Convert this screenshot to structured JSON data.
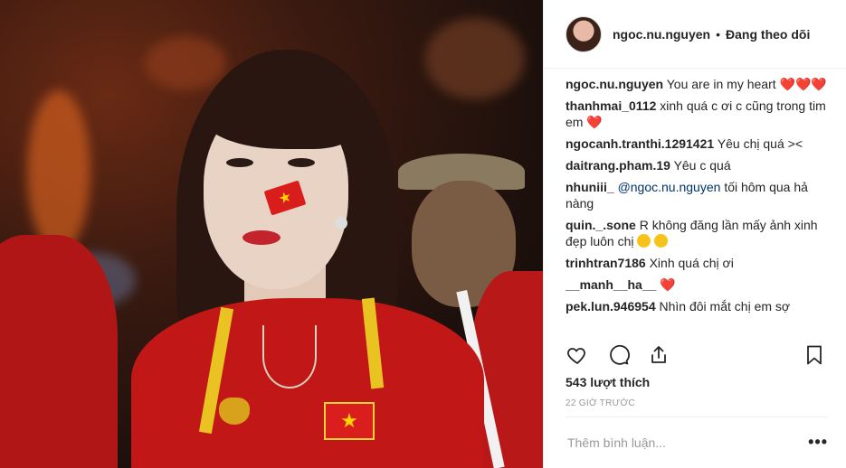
{
  "post": {
    "image_alt": "photo-of-fan-with-vietnam-flag"
  },
  "header": {
    "username": "ngoc.nu.nguyen",
    "separator": "•",
    "follow_status": "Đang theo dõi"
  },
  "comments": [
    {
      "user": "ngoc.nu.nguyen",
      "text": "You are in my heart",
      "hearts": "❤️❤️❤️"
    },
    {
      "user": "thanhmai_0112",
      "text": "xinh quá c ơi c cũng trong tim em",
      "hearts": "❤️"
    },
    {
      "user": "ngocanh.tranthi.1291421",
      "text": "Yêu chị quá ><"
    },
    {
      "user": "daitrang.pham.19",
      "text": "Yêu c quá"
    },
    {
      "user": "nhuniii_",
      "mention": "@ngoc.nu.nguyen",
      "text": "tối hôm qua hả nàng"
    },
    {
      "user": "quin._.sone",
      "text": "R không đăng lần mấy ảnh xinh đẹp luôn chị"
    },
    {
      "user": "trinhtran7186",
      "text": "Xinh quá chị ơi"
    },
    {
      "user": "__manh__ha__",
      "hearts": "❤️"
    },
    {
      "user": "pek.lun.946954",
      "text": "Nhìn đôi mắt chị em sợ"
    }
  ],
  "actions": {
    "like_icon": "heart-outline-icon",
    "comment_icon": "comment-bubble-icon",
    "share_icon": "share-upload-icon",
    "save_icon": "bookmark-icon"
  },
  "likes": "543 lượt thích",
  "timestamp": "22 GIỜ TRƯỚC",
  "add_comment": {
    "placeholder": "Thêm bình luận...",
    "more": "•••"
  },
  "colors": {
    "heart": "#e11d2e",
    "mention": "#003569",
    "muted": "#999999",
    "divider": "#efefef"
  }
}
